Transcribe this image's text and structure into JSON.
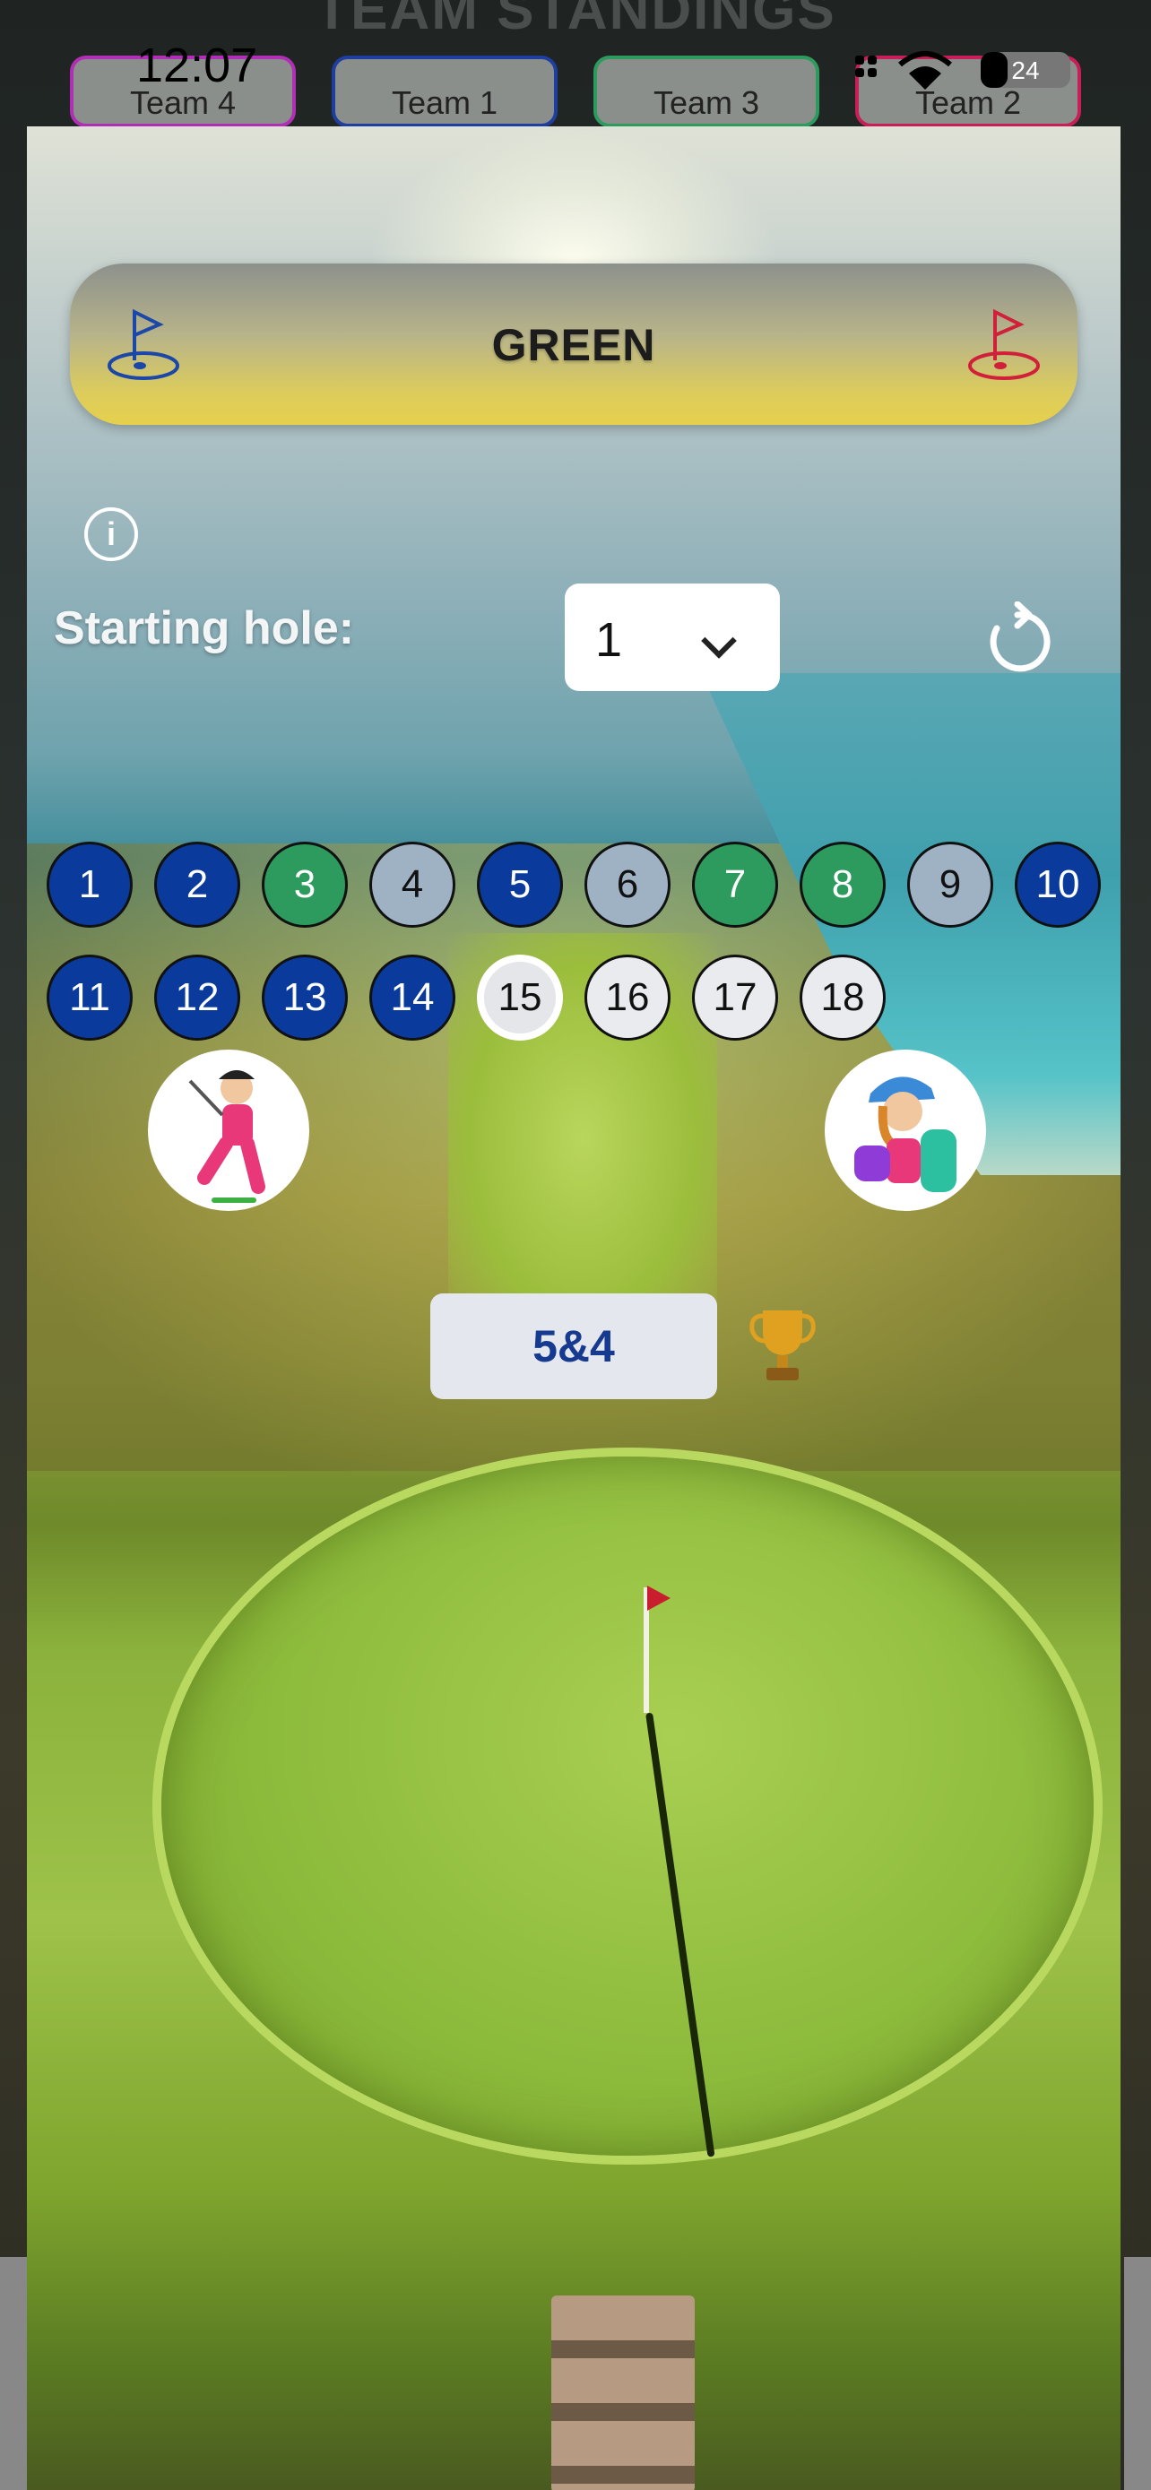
{
  "status_bar": {
    "time": "12:07",
    "battery": "24"
  },
  "background": {
    "title": "TEAM STANDINGS",
    "teams": [
      "Team 4",
      "Team 1",
      "Team 3",
      "Team 2"
    ],
    "team_colors": [
      "#b12fb5",
      "#1f3fa0",
      "#2d9b5d",
      "#c81e5a"
    ]
  },
  "header": {
    "title": "GREEN",
    "left_flag_color": "#1a47a8",
    "right_flag_color": "#d1213a"
  },
  "starting_hole": {
    "label": "Starting hole:",
    "value": "1"
  },
  "holes": {
    "row1": [
      {
        "n": "1",
        "state": "blue"
      },
      {
        "n": "2",
        "state": "blue"
      },
      {
        "n": "3",
        "state": "green"
      },
      {
        "n": "4",
        "state": "gray"
      },
      {
        "n": "5",
        "state": "blue"
      },
      {
        "n": "6",
        "state": "gray"
      },
      {
        "n": "7",
        "state": "green"
      },
      {
        "n": "8",
        "state": "green"
      },
      {
        "n": "9",
        "state": "gray"
      },
      {
        "n": "10",
        "state": "blue"
      }
    ],
    "row2": [
      {
        "n": "11",
        "state": "blue"
      },
      {
        "n": "12",
        "state": "blue"
      },
      {
        "n": "13",
        "state": "blue"
      },
      {
        "n": "14",
        "state": "blue"
      },
      {
        "n": "15",
        "state": "current"
      },
      {
        "n": "16",
        "state": "white"
      },
      {
        "n": "17",
        "state": "white"
      },
      {
        "n": "18",
        "state": "white"
      }
    ]
  },
  "match": {
    "result": "5&4"
  },
  "colors": {
    "blue": "#0a3b9c",
    "green": "#2d9b5d",
    "gray": "#9fb2c4",
    "white": "#e9ebef",
    "score_text": "#153a8f"
  }
}
